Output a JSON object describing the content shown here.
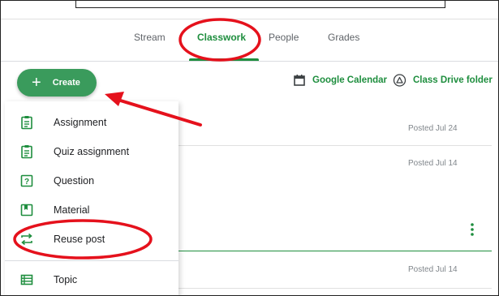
{
  "tabs": [
    {
      "label": "Stream"
    },
    {
      "label": "Classwork"
    },
    {
      "label": "People"
    },
    {
      "label": "Grades"
    }
  ],
  "active_tab": "Classwork",
  "create_button": {
    "label": "Create",
    "icon": "plus-icon"
  },
  "toolbar": {
    "calendar_label": "Google Calendar",
    "calendar_icon": "calendar-icon",
    "drive_label": "Class Drive folder",
    "drive_icon": "drive-icon"
  },
  "menu": {
    "items": [
      {
        "label": "Assignment",
        "icon": "assignment-icon"
      },
      {
        "label": "Quiz assignment",
        "icon": "quiz-assignment-icon"
      },
      {
        "label": "Question",
        "icon": "question-icon"
      },
      {
        "label": "Material",
        "icon": "material-icon"
      },
      {
        "label": "Reuse post",
        "icon": "reuse-post-icon"
      },
      {
        "label": "Topic",
        "icon": "topic-icon"
      }
    ]
  },
  "stream_items": [
    {
      "posted": "Posted Jul 24"
    },
    {
      "posted": "Posted Jul 14"
    },
    {
      "posted": "Posted Jul 14"
    }
  ],
  "colors": {
    "accent_green": "#1e8e3e",
    "create_green": "#3a9b5c",
    "annotation_red": "#e5111c"
  }
}
